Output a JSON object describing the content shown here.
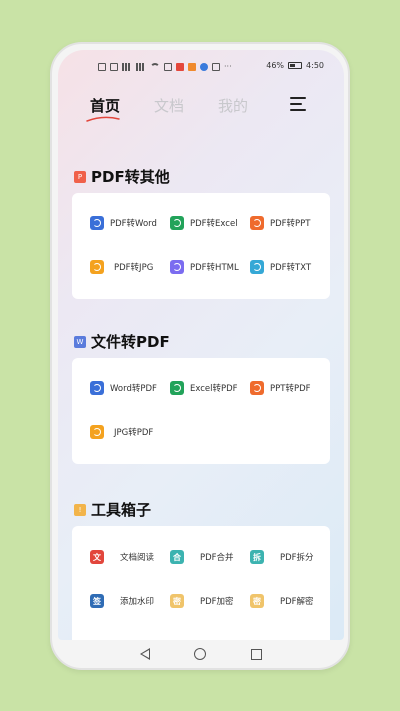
{
  "status_bar": {
    "battery": "46%",
    "time": "4:50",
    "more": "···"
  },
  "tabs": [
    {
      "label": "首页",
      "active": true
    },
    {
      "label": "文档",
      "active": false
    },
    {
      "label": "我的",
      "active": false
    }
  ],
  "sections": [
    {
      "title": "PDF转其他",
      "badge": "P",
      "badge_color": "#f0614a",
      "items": [
        {
          "label": "PDF转Word",
          "color": "#3a6fd8"
        },
        {
          "label": "PDF转Excel",
          "color": "#22a35a"
        },
        {
          "label": "PDF转PPT",
          "color": "#ef6b2d"
        },
        {
          "label": "PDF转JPG",
          "color": "#f4a21f"
        },
        {
          "label": "PDF转HTML",
          "color": "#7b6cf0"
        },
        {
          "label": "PDF转TXT",
          "color": "#35a8d6"
        }
      ]
    },
    {
      "title": "文件转PDF",
      "badge": "W",
      "badge_color": "#5a7bdc",
      "items": [
        {
          "label": "Word转PDF",
          "color": "#3a6fd8"
        },
        {
          "label": "Excel转PDF",
          "color": "#22a35a"
        },
        {
          "label": "PPT转PDF",
          "color": "#ef6b2d"
        },
        {
          "label": "JPG转PDF",
          "color": "#f4a21f"
        }
      ]
    },
    {
      "title": "工具箱子",
      "badge": "!",
      "badge_color": "#f2b44a",
      "items": [
        {
          "label": "文档阅读",
          "icon_text": "文",
          "color": "#e2463c"
        },
        {
          "label": "PDF合并",
          "icon_text": "合",
          "color": "#3cb3b0"
        },
        {
          "label": "PDF拆分",
          "icon_text": "拆",
          "color": "#3cb3b0"
        },
        {
          "label": "添加水印",
          "icon_text": "签",
          "color": "#2f6cb5"
        },
        {
          "label": "PDF加密",
          "icon_text": "密",
          "color": "#f0c46a"
        },
        {
          "label": "PDF解密",
          "icon_text": "密",
          "color": "#f0c46a"
        }
      ]
    }
  ]
}
